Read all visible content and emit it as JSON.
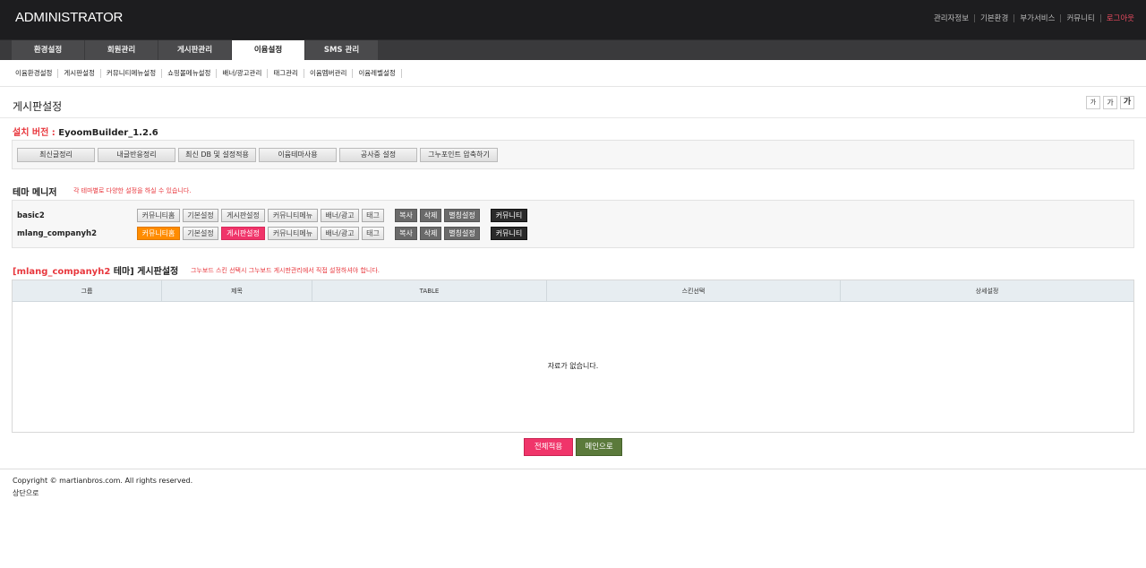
{
  "header": {
    "logo": "ADMINISTRATOR",
    "links": [
      "관리자정보",
      "기본환경",
      "부가서비스",
      "커뮤니티",
      "로그아웃"
    ]
  },
  "mainnav": [
    "환경설정",
    "회원관리",
    "게시판관리",
    "이윰설정",
    "SMS 관리"
  ],
  "subnav": [
    "이윰환경설정",
    "게시판설정",
    "커뮤니티메뉴설정",
    "쇼핑몰메뉴설정",
    "배너/광고관리",
    "태그관리",
    "이윰멤버관리",
    "이윰레벨설정"
  ],
  "page": {
    "title": "게시판설정",
    "font_sizes": [
      "가",
      "가",
      "가"
    ]
  },
  "version": {
    "label": "설치 버전 :",
    "value": "EyoomBuilder_1.2.6"
  },
  "tools": [
    "최신글정리",
    "내글반응정리",
    "최신 DB 및 설정적용",
    "이윰테마사용",
    "공사중 설정",
    "그누포인트 압축하기"
  ],
  "theme_manager": {
    "title": "테마 메니저",
    "desc": "각 테마별로 다양한 설정을 하실 수 있습니다.",
    "themes": [
      {
        "name": "basic2"
      },
      {
        "name": "mlang_companyh2"
      }
    ],
    "buttons": [
      "커뮤니티홈",
      "기본설정",
      "게시판설정",
      "커뮤니티메뉴",
      "배너/광고",
      "태그"
    ],
    "actions": [
      "복사",
      "삭제",
      "별칭설정"
    ],
    "mode": "커뮤니티"
  },
  "board": {
    "title_theme": "[mlang_companyh2",
    "title_rest": "테마] 게시판설정",
    "desc": "그누보드 스킨 선택시 그누보드 게시판관리에서 직접 설정하셔야 합니다.",
    "columns": [
      "그룹",
      "제목",
      "TABLE",
      "스킨선택",
      "상세설정"
    ],
    "empty": "자료가 없습니다."
  },
  "buttons": {
    "apply": "전체적용",
    "main": "메인으로"
  },
  "footer": {
    "copyright": "Copyright © martianbros.com. All rights reserved.",
    "totop": "상단으로"
  }
}
